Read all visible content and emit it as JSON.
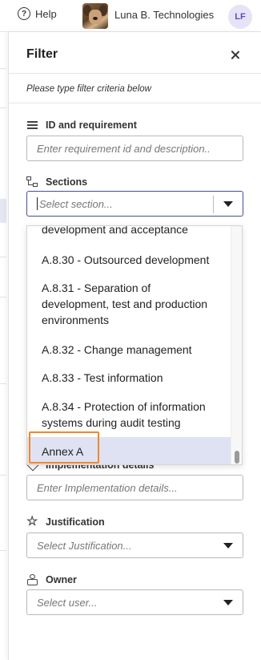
{
  "topbar": {
    "help_label": "Help",
    "help_icon": "?",
    "company_name": "Luna B. Technologies",
    "user_initials": "LF"
  },
  "panel": {
    "title": "Filter",
    "hint": "Please type filter criteria below"
  },
  "fields": {
    "id_requirement": {
      "label": "ID and requirement",
      "placeholder": "Enter requirement id and description.."
    },
    "sections": {
      "label": "Sections",
      "placeholder": "Select section..."
    },
    "implementation": {
      "label": "Implementation details",
      "placeholder": "Enter Implementation details..."
    },
    "justification": {
      "label": "Justification",
      "placeholder": "Select Justification..."
    },
    "owner": {
      "label": "Owner",
      "placeholder": "Select user..."
    }
  },
  "dropdown": {
    "options": [
      "development and acceptance",
      "A.8.30 - Outsourced development",
      "A.8.31 - Separation of development, test and production environments",
      "A.8.32 - Change management",
      "A.8.33 - Test information",
      "A.8.34 - Protection of information systems during audit testing",
      "Annex A"
    ],
    "highlighted": "Annex A"
  },
  "colors": {
    "accent": "#4a4f8f",
    "highlight": "#dfe2f3",
    "annotation": "#f0882a",
    "avatar_bg": "#e6e3f7"
  }
}
